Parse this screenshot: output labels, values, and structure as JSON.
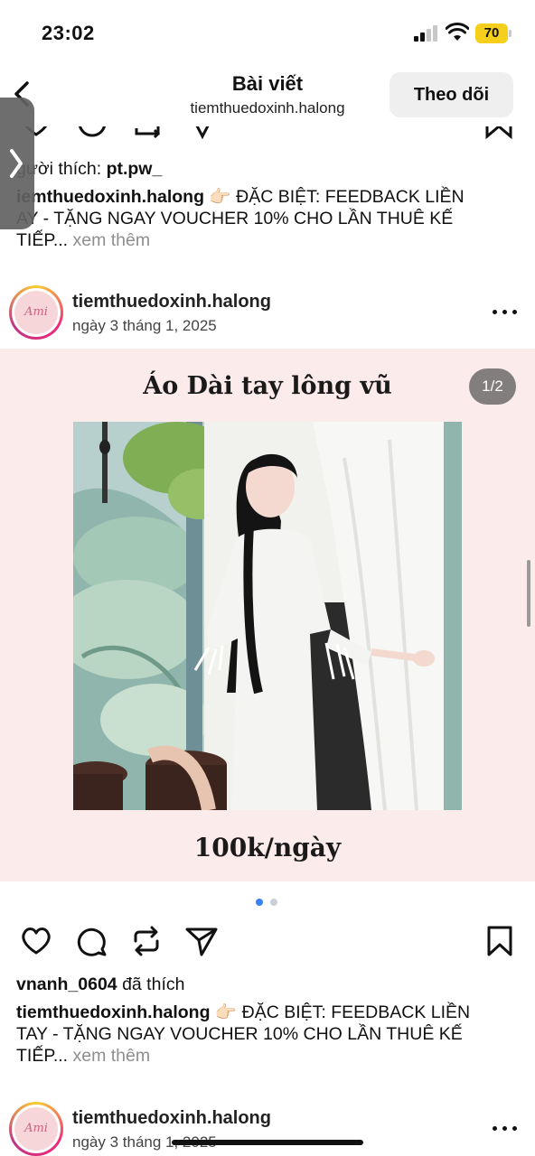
{
  "status_bar": {
    "time": "23:02",
    "battery": "70"
  },
  "nav": {
    "title": "Bài viết",
    "subtitle": "tiemthuedoxinh.halong",
    "follow_label": "Theo dõi"
  },
  "prev_post": {
    "liked_prefix": "gười thích: ",
    "liked_user": "pt.pw_",
    "caption_user": "iemthuedoxinh.halong",
    "caption_line1": " 👉🏻 ĐẶC BIỆT: FEEDBACK LIỀN",
    "caption_line2": "AY - TẶNG NGAY VOUCHER 10% CHO LẦN THUÊ KẾ",
    "caption_line3": "TIẾP...",
    "more_label": " xem thêm"
  },
  "post": {
    "avatar_text": "Ami",
    "username": "tiemthuedoxinh.halong",
    "date": "ngày 3 tháng 1, 2025",
    "media_title": "Áo Dài tay lông vũ",
    "counter": "1/2",
    "price": "100k/ngày",
    "liked_user": "vnanh_0604",
    "liked_suffix": " đã thích",
    "caption_user": "tiemthuedoxinh.halong",
    "caption_line1": " 👉🏻 ĐẶC BIỆT: FEEDBACK LIỀN",
    "caption_line2": "TAY - TẶNG NGAY VOUCHER 10% CHO LẦN THUÊ KẾ",
    "caption_line3": "TIẾP...",
    "more_label": " xem thêm"
  },
  "next_post": {
    "avatar_text": "Ami",
    "username": "tiemthuedoxinh.halong",
    "date": "ngày 3 tháng 1, 2025"
  },
  "icons": {
    "like": "heart-icon",
    "comment": "comment-icon",
    "repost": "repost-icon",
    "share": "send-icon",
    "save": "bookmark-icon",
    "back": "chevron-left-icon",
    "more": "more-horizontal-icon",
    "side_tab": "chevron-right-icon"
  },
  "colors": {
    "media_bg": "#fcebeb",
    "dot_active": "#3b82f6",
    "dot_inactive": "#c9d0d8",
    "battery": "#f5cf1c",
    "follow_bg": "#efefef"
  }
}
